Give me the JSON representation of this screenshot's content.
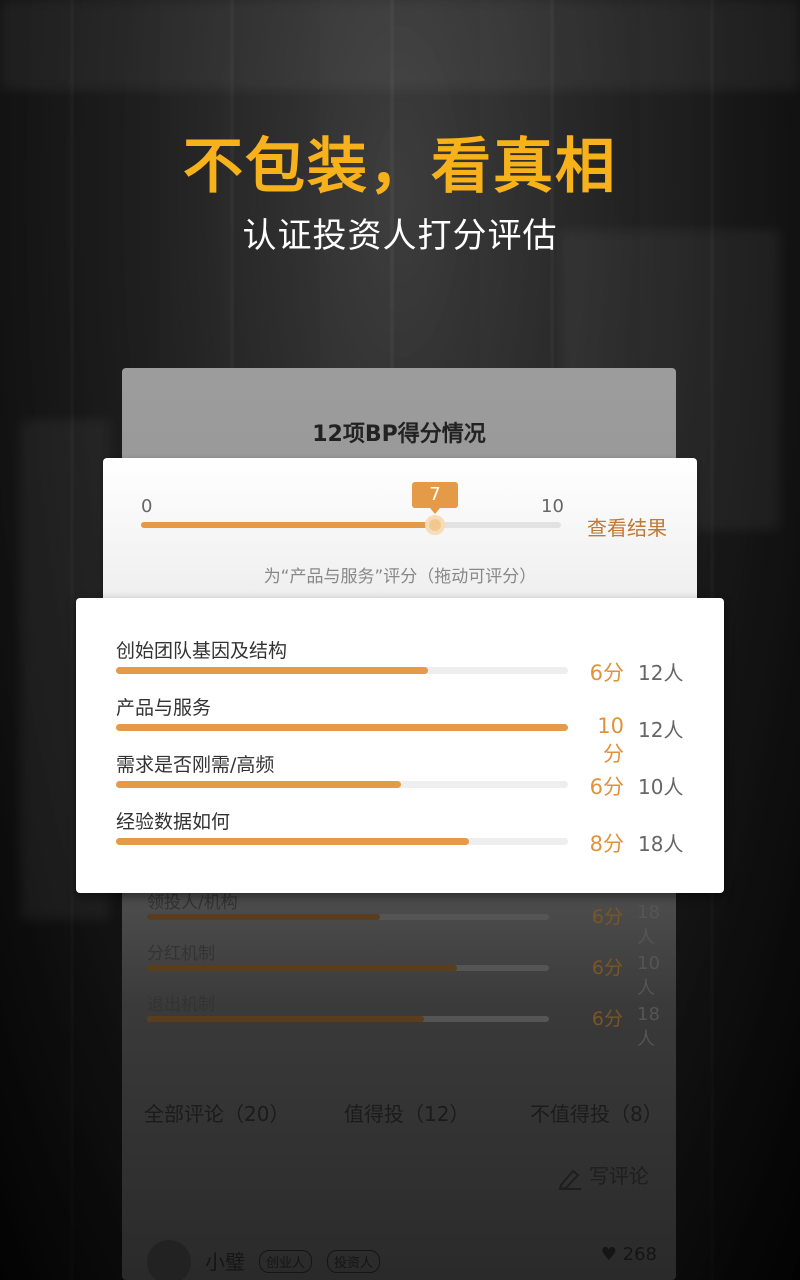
{
  "hero": {
    "title": "不包装，看真相",
    "subtitle": "认证投资人打分评估"
  },
  "back_card": {
    "title": "12项BP得分情况",
    "rows": [
      {
        "label": "领投人/机构",
        "fill": 0.58,
        "score": "6分",
        "count": "18人"
      },
      {
        "label": "分红机制",
        "fill": 0.77,
        "score": "6分",
        "count": "10人"
      },
      {
        "label": "退出机制",
        "fill": 0.69,
        "score": "6分",
        "count": "18人"
      }
    ],
    "tabs": {
      "all": "全部评论（20）",
      "worth": "值得投（12）",
      "not_worth": "不值得投（8）"
    },
    "write_comment": "写评论",
    "comment": {
      "name": "小璧",
      "badge1": "创业人",
      "badge2": "投资人",
      "likes": "268"
    }
  },
  "slider": {
    "min": "0",
    "max": "10",
    "value": 7,
    "value_label": "7",
    "result_link": "查看结果",
    "hint": "为“产品与服务”评分（拖动可评分）"
  },
  "scores": [
    {
      "label": "创始团队基因及结构",
      "fill": 0.69,
      "score": "6分",
      "count": "12人"
    },
    {
      "label": "产品与服务",
      "fill": 1.0,
      "score": "10分",
      "count": "12人"
    },
    {
      "label": "需求是否刚需/高频",
      "fill": 0.63,
      "score": "6分",
      "count": "10人"
    },
    {
      "label": "经验数据如何",
      "fill": 0.78,
      "score": "8分",
      "count": "18人"
    }
  ],
  "colors": {
    "accent": "#e49a46",
    "hero_title": "#f7b21b"
  }
}
